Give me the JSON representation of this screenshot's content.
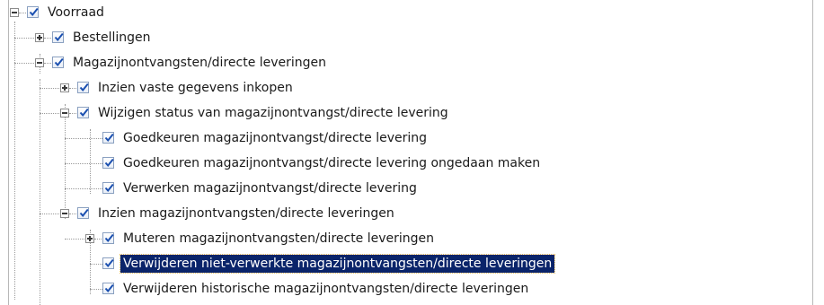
{
  "tree": {
    "nodes": [
      {
        "label": "Voorraad",
        "checked": true,
        "expander": "expanded"
      },
      {
        "label": "Bestellingen",
        "checked": true,
        "expander": "collapsed"
      },
      {
        "label": "Magazijnontvangsten/directe leveringen",
        "checked": true,
        "expander": "expanded"
      },
      {
        "label": "Inzien vaste gegevens inkopen",
        "checked": true,
        "expander": "collapsed"
      },
      {
        "label": "Wijzigen status van magazijnontvangst/directe levering",
        "checked": true,
        "expander": "expanded"
      },
      {
        "label": "Goedkeuren magazijnontvangst/directe levering",
        "checked": true,
        "expander": "none"
      },
      {
        "label": "Goedkeuren magazijnontvangst/directe levering ongedaan maken",
        "checked": true,
        "expander": "none"
      },
      {
        "label": "Verwerken magazijnontvangst/directe levering",
        "checked": true,
        "expander": "none"
      },
      {
        "label": "Inzien magazijnontvangsten/directe leveringen",
        "checked": true,
        "expander": "expanded"
      },
      {
        "label": "Muteren magazijnontvangsten/directe leveringen",
        "checked": true,
        "expander": "collapsed"
      },
      {
        "label": "Verwijderen niet-verwerkte magazijnontvangsten/directe leveringen",
        "checked": true,
        "expander": "none",
        "selected": true
      },
      {
        "label": "Verwijderen historische magazijnontvangsten/directe leveringen",
        "checked": true,
        "expander": "none"
      }
    ]
  },
  "colors": {
    "selection_bg": "#0a246a",
    "check_mark": "#1a4fb0",
    "tree_lines": "#9a9a9a"
  }
}
